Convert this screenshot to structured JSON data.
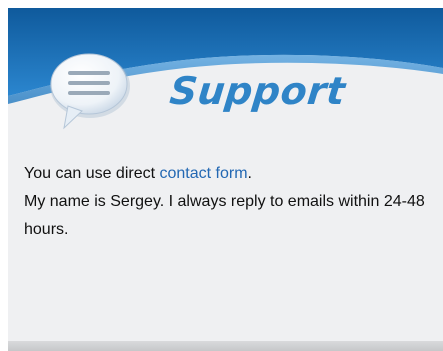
{
  "header": {
    "title": "Support",
    "icon": "speech-bubble-icon"
  },
  "content": {
    "line1_prefix": "You can use direct ",
    "contact_link": "contact form",
    "line1_suffix": ".",
    "line2": "My name is Sergey. I always reply to emails within 24-48 hours."
  },
  "colors": {
    "header_blue": "#1f6fb3",
    "title_blue": "#2f84c7",
    "link": "#2368b3",
    "panel_bg": "#eff0f2"
  }
}
